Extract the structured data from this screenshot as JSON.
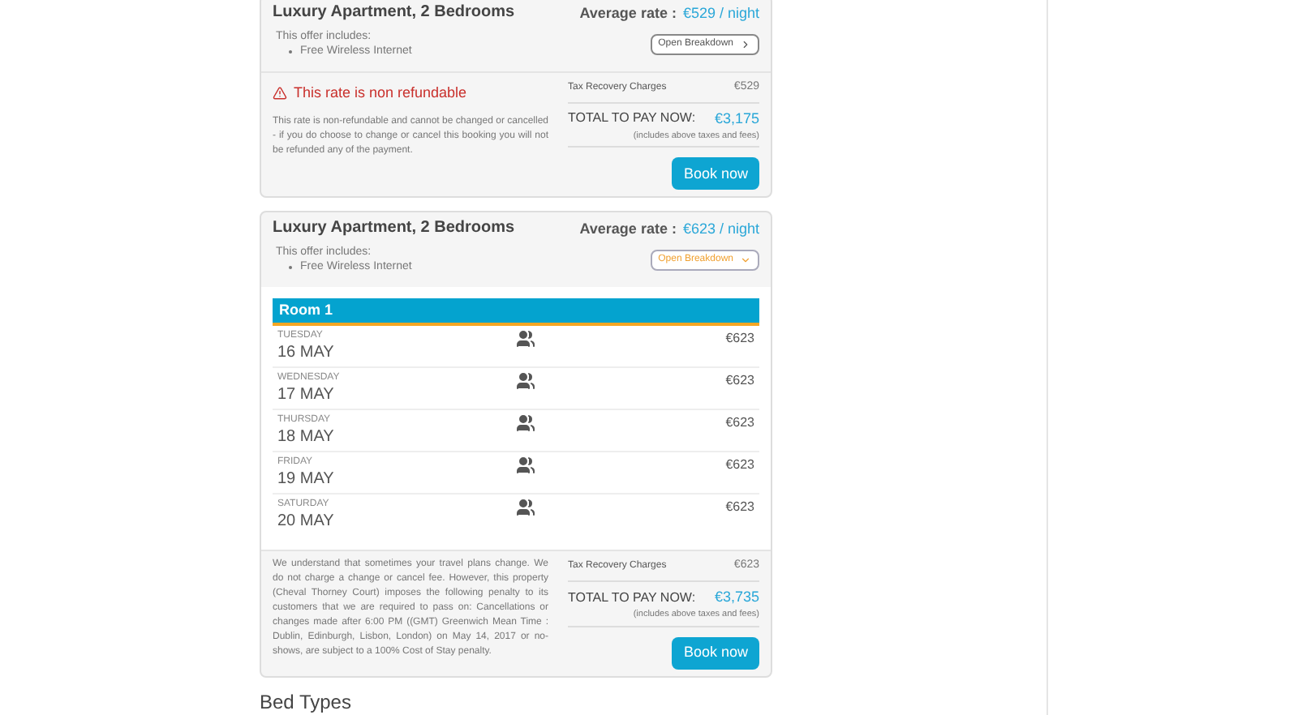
{
  "offers": [
    {
      "title": "Luxury Apartment, 2 Bedrooms",
      "rate_label": "Average rate :",
      "rate": "€529 / night",
      "includes_label": "This offer includes:",
      "includes": [
        "Free Wireless Internet"
      ],
      "breakdown": {
        "label": "Open Breakdown",
        "expanded": false
      },
      "warning": "This rate is non refundable",
      "policy": "This rate is non-refundable and cannot be changed or cancelled - if you do choose to change or cancel this booking you will not be refunded any of the payment.",
      "tax_label": "Tax Recovery Charges",
      "tax": "€529",
      "total_label": "TOTAL TO PAY NOW:",
      "total": "€3,175",
      "total_note": "(includes above taxes and fees)",
      "button": "Book now"
    },
    {
      "title": "Luxury Apartment, 2 Bedrooms",
      "rate_label": "Average rate :",
      "rate": "€623 / night",
      "includes_label": "This offer includes:",
      "includes": [
        "Free Wireless Internet"
      ],
      "breakdown": {
        "label": "Open Breakdown",
        "expanded": true
      },
      "room": {
        "name": "Room 1",
        "nights": [
          {
            "weekday": "TUESDAY",
            "date": "16 MAY",
            "price": "€623"
          },
          {
            "weekday": "WEDNESDAY",
            "date": "17 MAY",
            "price": "€623"
          },
          {
            "weekday": "THURSDAY",
            "date": "18 MAY",
            "price": "€623"
          },
          {
            "weekday": "FRIDAY",
            "date": "19 MAY",
            "price": "€623"
          },
          {
            "weekday": "SATURDAY",
            "date": "20 MAY",
            "price": "€623"
          }
        ]
      },
      "policy": "We understand that sometimes your travel plans change. We do not charge a change or cancel fee. However, this property (Cheval Thorney Court) imposes the following penalty to its customers that we are required to pass on: Cancellations or changes made after 6:00 PM ((GMT) Greenwich Mean Time : Dublin, Edinburgh, Lisbon, London) on May 14, 2017 or no-shows, are subject to a 100% Cost of Stay penalty.",
      "tax_label": "Tax Recovery Charges",
      "tax": "€623",
      "total_label": "TOTAL TO PAY NOW:",
      "total": "€3,735",
      "total_note": "(includes above taxes and fees)",
      "button": "Book now"
    }
  ],
  "section_heading": "Bed Types"
}
